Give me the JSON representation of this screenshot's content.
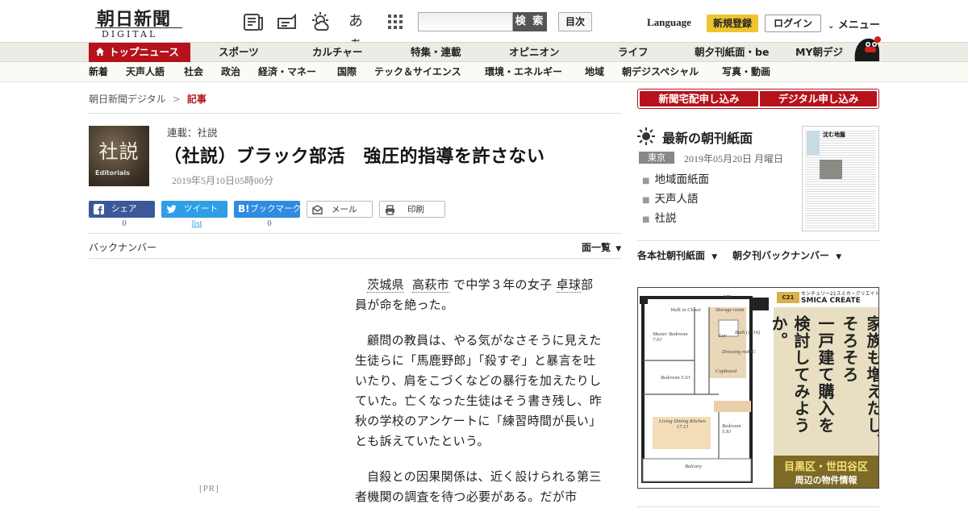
{
  "header": {
    "logo_main": "朝日新聞",
    "logo_sub": "DIGITAL",
    "text_size_label": "あぁ",
    "search_placeholder": "",
    "search_button": "検 索",
    "toc_button": "目次",
    "language": "Language",
    "register": "新規登録",
    "login": "ログイン",
    "menu": "メニュー"
  },
  "main_nav": [
    {
      "label": "トップニュース",
      "active": true
    },
    {
      "label": "スポーツ"
    },
    {
      "label": "カルチャー"
    },
    {
      "label": "特集・連載"
    },
    {
      "label": "オピニオン"
    },
    {
      "label": "ライフ"
    },
    {
      "label": "朝夕刊紙面・be"
    },
    {
      "label": "MY朝デジ"
    }
  ],
  "sub_nav": [
    "新着",
    "天声人語",
    "社会",
    "政治",
    "経済・マネー",
    "国際",
    "テック＆サイエンス",
    "環境・エネルギー",
    "地域",
    "朝デジスペシャル",
    "写真・動画"
  ],
  "breadcrumb": {
    "root": "朝日新聞デジタル",
    "separator": ">",
    "current": "記事"
  },
  "article": {
    "thumb_title": "社説",
    "thumb_sub": "Editorials",
    "series": "連載：社説",
    "headline": "（社説）ブラック部活　強圧的指導を許さない",
    "date": "2019年5月10日05時00分",
    "share": {
      "facebook": "シェア",
      "twitter": "ツイート",
      "hatena": "ブックマーク",
      "mail": "メール",
      "print": "印刷",
      "facebook_count": "0",
      "twitter_count": "list",
      "hatena_count": "0"
    },
    "back_number": "バックナンバー",
    "page_list": "面一覧",
    "pr_label": "[PR]",
    "p1_kw1": "茨城県",
    "p1_kw2": "高萩市",
    "p1_mid": "で中学３年の女子",
    "p1_kw3": "卓球",
    "p1_end": "部員が命を絶った。",
    "p2": "顧問の教員は、やる気がなさそうに見えた生徒らに「馬鹿野郎」「殺すぞ」と暴言を吐いたり、肩をこづくなどの暴行を加えたりしていた。亡くなった生徒はそう書き残し、昨秋の学校のアンケートに「練習時間が長い」とも訴えていたという。",
    "p3": "自殺との因果関係は、近く設けられる第三者機関の調査を待つ必要がある。だが市"
  },
  "sidebar": {
    "sub_home": "新聞宅配申し込み",
    "sub_digital": "デジタル申し込み",
    "choukan_title": "最新の朝刊紙面",
    "region": "東京",
    "date": "2019年05月20日 月曜日",
    "links": [
      "地域面紙面",
      "天声人語",
      "社説"
    ],
    "paper_headline": "沈む地盤",
    "dropdown1": "各本社朝刊紙面",
    "dropdown2": "朝夕刊バックナンバー"
  },
  "ad": {
    "brand_logo": "C21",
    "brand_line1": "センチュリー21スミカ・クリエイト",
    "brand_line2": "SMICA CREATE",
    "copy_cols": [
      "家族も増えたし、",
      "そろそろ",
      "一戸建て購入を",
      "検討してみようか。"
    ],
    "area": "目黒区・世田谷区",
    "area_sub": "周辺の物件情報",
    "plan_labels": [
      "Walk in Closet",
      "Storage room",
      "Master Bedroom 7.0J",
      "Bath (1616)",
      "Lav",
      "Dressing room",
      "WC",
      "Bedroom 5.0J",
      "Cupboard",
      "Living Dining Kitchen 17.1J",
      "Bedroom 5.8J",
      "Balcony",
      "MB"
    ]
  },
  "colors": {
    "accent": "#b5121b",
    "register": "#f0c430",
    "facebook": "#3b5998",
    "twitter": "#2e9fe6",
    "hatena": "#2e8be0"
  }
}
